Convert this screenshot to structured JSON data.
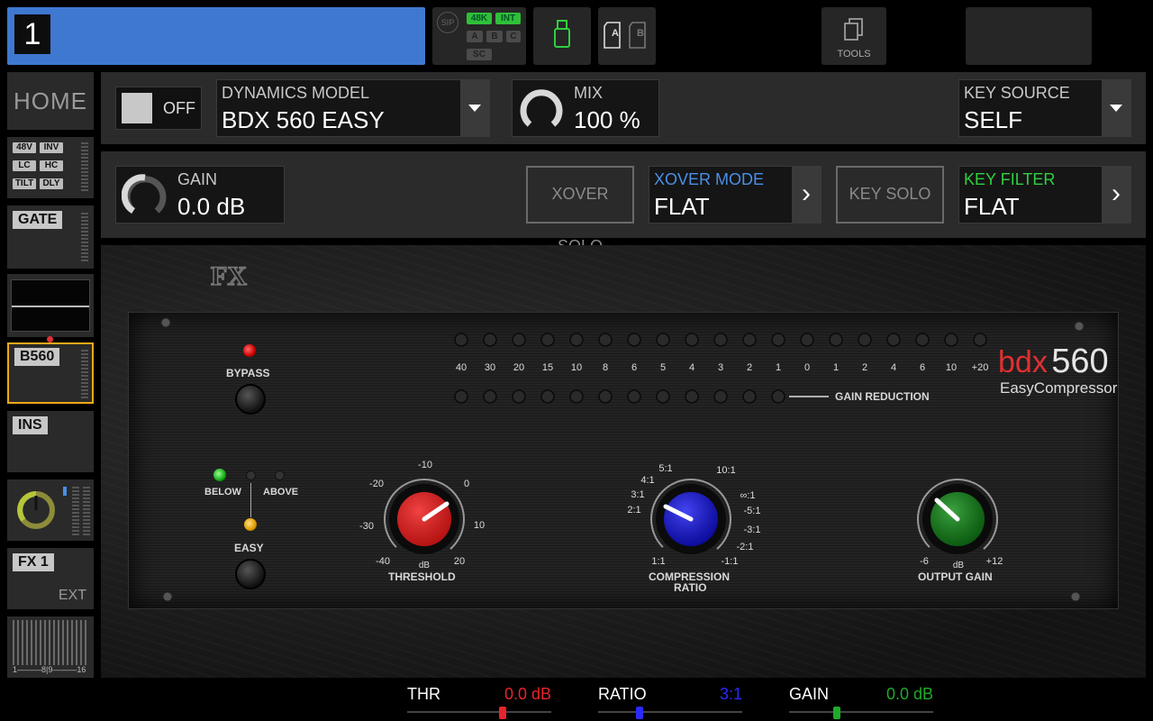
{
  "top_bar": {
    "channel_number": "1",
    "status": {
      "sip": "SIP",
      "rate": "48K",
      "clock": "INT",
      "a": "A",
      "b": "B",
      "c": "C",
      "sc": "SC"
    },
    "sd_a": "A",
    "sd_b": "B",
    "tools_label": "TOOLS"
  },
  "sidebar": {
    "home_label": "HOME",
    "input_tags": [
      "48V",
      "INV",
      "LC",
      "HC",
      "TILT",
      "DLY"
    ],
    "gate_label": "GATE",
    "insert_label": "B560",
    "ins_label": "INS",
    "fx_label": "FX 1",
    "fx_ext_label": "EXT",
    "bus_scale": "1———8|9———16"
  },
  "row1": {
    "power_label": "OFF",
    "model_label": "DYNAMICS MODEL",
    "model_value": "BDX 560 EASY",
    "mix_label": "MIX",
    "mix_value": "100 %",
    "key_source_label": "KEY SOURCE",
    "key_source_value": "SELF"
  },
  "row2": {
    "gain_label": "GAIN",
    "gain_value": "0.0 dB",
    "xover_solo": "XOVER SOLO",
    "xover_mode_label": "XOVER MODE",
    "xover_mode_value": "FLAT",
    "key_solo": "KEY SOLO",
    "key_filter_label": "KEY FILTER",
    "key_filter_value": "FLAT"
  },
  "plugin": {
    "brand": "bdx",
    "model": "560",
    "subtitle": "EasyCompressor",
    "bypass": "BYPASS",
    "below": "BELOW",
    "above": "ABOVE",
    "easy": "EASY",
    "meter_scale": [
      "40",
      "30",
      "20",
      "15",
      "10",
      "8",
      "6",
      "5",
      "4",
      "3",
      "2",
      "1",
      "0",
      "1",
      "2",
      "4",
      "6",
      "10",
      "+20"
    ],
    "gain_reduction_label": "GAIN REDUCTION",
    "threshold": {
      "label": "THRESHOLD",
      "unit": "dB",
      "scale": [
        "-40",
        "-30",
        "-20",
        "-10",
        "0",
        "10",
        "20"
      ]
    },
    "ratio": {
      "label1": "COMPRESSION",
      "label2": "RATIO",
      "scale": [
        "1:1",
        "2:1",
        "3:1",
        "4:1",
        "5:1",
        "10:1",
        "∞:1",
        "-5:1",
        "-3:1",
        "-2:1",
        "-1:1"
      ]
    },
    "output": {
      "label": "OUTPUT GAIN",
      "unit": "dB",
      "min": "-6",
      "max": "+12"
    }
  },
  "bottom": {
    "thr_name": "THR",
    "thr_value": "0.0 dB",
    "thr_color": "#e8242a",
    "thr_fraction": 0.66,
    "ratio_name": "RATIO",
    "ratio_value": "3:1",
    "ratio_color": "#2a2aff",
    "ratio_fraction": 0.29,
    "gain_name": "GAIN",
    "gain_value": "0.0 dB",
    "gain_color": "#1faa2a",
    "gain_fraction": 0.33
  },
  "colors": {
    "channel_bar": "#3f78d0",
    "accent_blue": "#4a8fe8",
    "accent_green": "#30d040",
    "selected_outline": "#f0a818"
  }
}
